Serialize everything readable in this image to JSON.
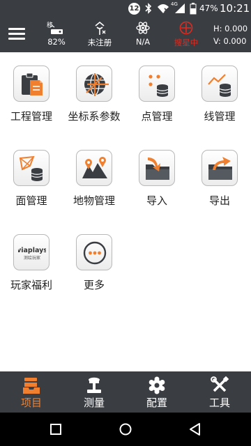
{
  "status_bar": {
    "notification_count": "12",
    "signal_label": "4G",
    "battery_percent": "47%",
    "time": "10:21",
    "icons": [
      "bluetooth-icon",
      "wifi-icon",
      "signal-icon",
      "battery-icon"
    ]
  },
  "top_bar": {
    "mobile_label": "移",
    "mobile_value": "82%",
    "registration": "未注册",
    "satellite": "N/A",
    "mode": "搜星中",
    "coord_h": "H: 0.000",
    "coord_v": "V: 0.000"
  },
  "tiles": [
    {
      "label": "工程管理",
      "icon": "project-manage-icon"
    },
    {
      "label": "坐标系参数",
      "icon": "coordinate-system-icon"
    },
    {
      "label": "点管理",
      "icon": "point-manage-icon"
    },
    {
      "label": "线管理",
      "icon": "line-manage-icon"
    },
    {
      "label": "面管理",
      "icon": "area-manage-icon"
    },
    {
      "label": "地物管理",
      "icon": "feature-manage-icon"
    },
    {
      "label": "导入",
      "icon": "import-icon"
    },
    {
      "label": "导出",
      "icon": "export-icon"
    },
    {
      "label": "玩家福利",
      "icon": "player-welfare-icon",
      "logo_text": "viaplays",
      "logo_subtext": "测绘玩家"
    },
    {
      "label": "更多",
      "icon": "more-icon"
    }
  ],
  "bottom_nav": [
    {
      "label": "项目",
      "icon": "project-icon",
      "active": true
    },
    {
      "label": "测量",
      "icon": "survey-icon",
      "active": false
    },
    {
      "label": "配置",
      "icon": "config-icon",
      "active": false
    },
    {
      "label": "工具",
      "icon": "tools-icon",
      "active": false
    }
  ],
  "colors": {
    "bar_background": "#3a3d42",
    "accent_orange": "#f08030",
    "alert_red": "#e02a1f"
  }
}
